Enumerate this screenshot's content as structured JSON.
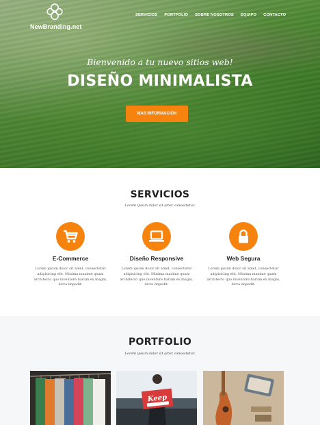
{
  "brand": {
    "name": "NewBranding.net"
  },
  "nav": {
    "items": [
      {
        "label": "SERVICIOS"
      },
      {
        "label": "PORTFOLIO"
      },
      {
        "label": "SOBRE NOSOTROS"
      },
      {
        "label": "EQUIPO"
      },
      {
        "label": "CONTACTO"
      }
    ]
  },
  "hero": {
    "subtitle": "Bienvenido a tu nuevo sitios web!",
    "title": "DISEÑO MINIMALISTA",
    "button_label": "MAS INFORMACIÓN"
  },
  "services": {
    "title": "SERVICIOS",
    "subtitle": "Lorem ipsum dolor sit amet consectetur.",
    "items": [
      {
        "icon": "cart-icon",
        "name": "E-Commerce",
        "description": "Lorem ipsum dolor sit amet, consectetur adipisicing elit. Minima maxime quam architecto quo inventore harum ex magni, dicta impedit."
      },
      {
        "icon": "laptop-icon",
        "name": "Diseño Responsive",
        "description": "Lorem ipsum dolor sit amet, consectetur adipisicing elit. Minima maxime quam architecto quo inventore harum ex magni, dicta impedit."
      },
      {
        "icon": "lock-icon",
        "name": "Web Segura",
        "description": "Lorem ipsum dolor sit amet, consectetur adipisicing elit. Minima maxime quam architecto quo inventore harum ex magni, dicta impedit."
      }
    ]
  },
  "portfolio": {
    "title": "PORTFOLIO",
    "subtitle": "Lorem ipsum dolor sit amet consectetur."
  },
  "colors": {
    "accent": "#f7830f",
    "heading": "#222222",
    "portfolio_bg": "#f6f7f9"
  }
}
